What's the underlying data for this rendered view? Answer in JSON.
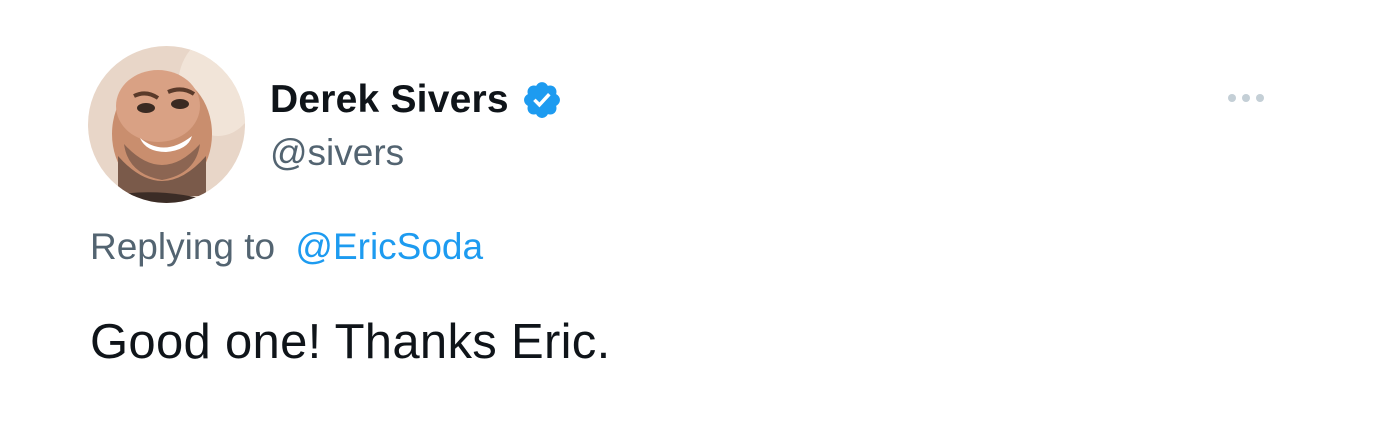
{
  "tweet": {
    "author": {
      "display_name": "Derek Sivers",
      "handle": "@sivers",
      "verified": true,
      "avatar_icon": "avatar-photo"
    },
    "reply_to": {
      "prefix": "Replying to",
      "mention": "@EricSoda"
    },
    "text": "Good one! Thanks Eric.",
    "more_icon": "more-horizontal-icon"
  },
  "colors": {
    "text_primary": "#0f1419",
    "text_secondary": "#536471",
    "accent": "#1d9bf0",
    "verified_badge": "#1d9bf0",
    "background": "#ffffff"
  }
}
